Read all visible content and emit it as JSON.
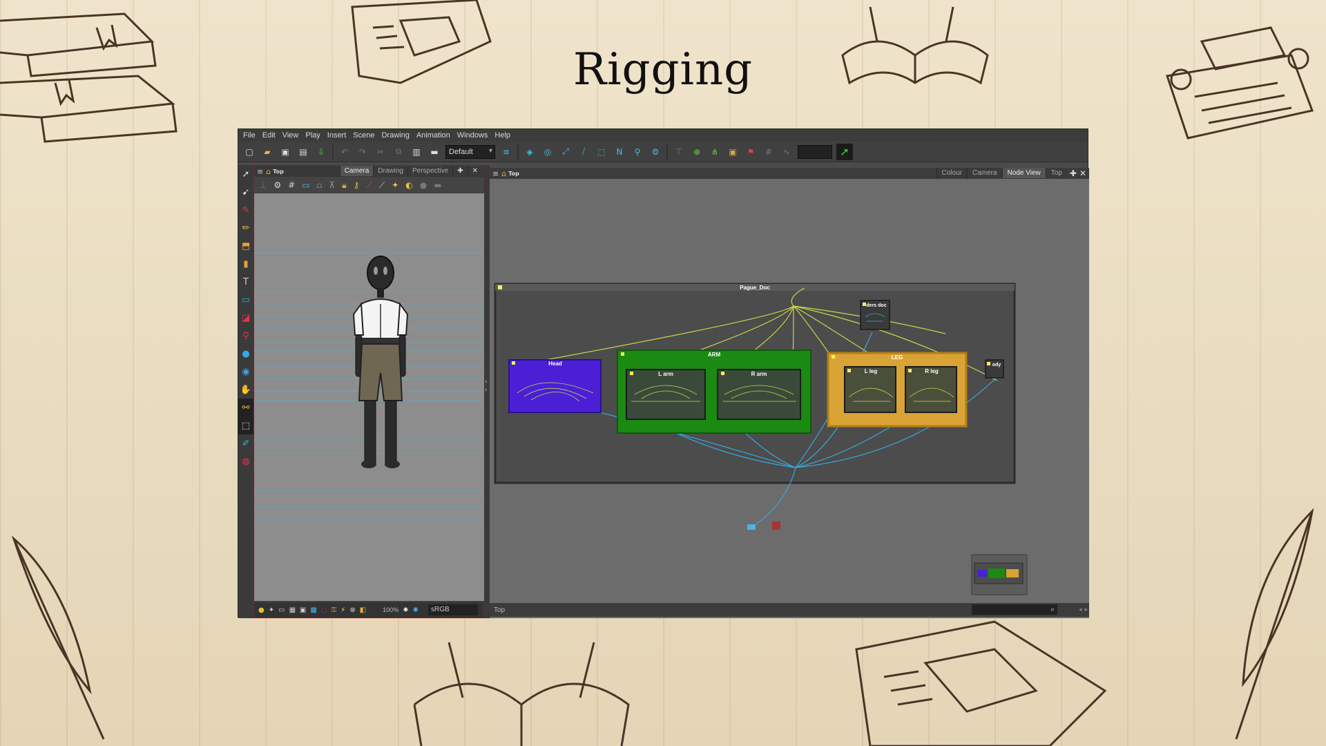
{
  "slide": {
    "title": "Rigging"
  },
  "menu": [
    "File",
    "Edit",
    "View",
    "Play",
    "Insert",
    "Scene",
    "Drawing",
    "Animation",
    "Windows",
    "Help"
  ],
  "toolbar": {
    "preset_label": "Default"
  },
  "camera_panel": {
    "title": "Top",
    "tabs": [
      "Camera",
      "Drawing",
      "Perspective"
    ],
    "active_tab": "Camera",
    "zoom_label": "100%",
    "color_space": "sRGB"
  },
  "node_view": {
    "title": "Top",
    "tabs": [
      "Colour",
      "Camera",
      "Node View",
      "Top"
    ],
    "active_tab": "Node View",
    "status_location": "Top",
    "groups": {
      "root": "Pague_Doc",
      "head": "Head",
      "arm": "ARM",
      "l_arm": "L arm",
      "r_arm": "R arm",
      "leg": "LEG",
      "l_leg": "L leg",
      "r_leg": "R leg",
      "ders_doc": "ders doc",
      "body": "ody"
    }
  },
  "colors": {
    "head_group": "#4b1fd6",
    "arm_group": "#1a8a12",
    "leg_group": "#d9a336",
    "wire_yellow": "#c8d84a",
    "wire_blue": "#38a9d8"
  }
}
